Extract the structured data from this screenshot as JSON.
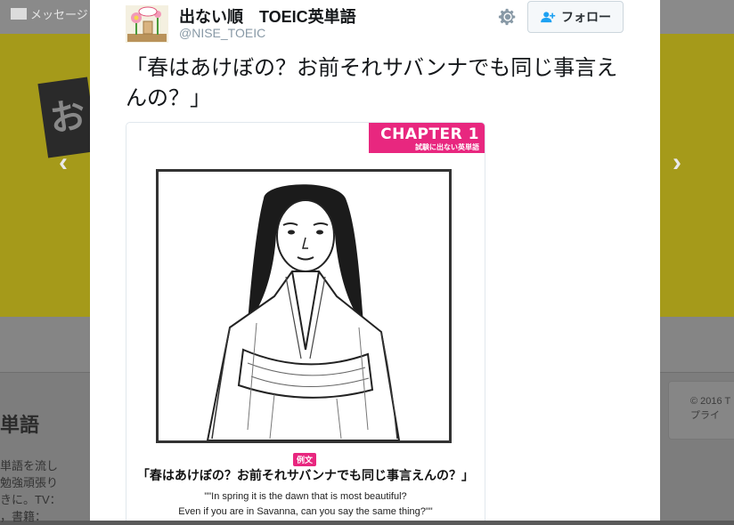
{
  "background": {
    "messages_label": "メッセージ",
    "logo_glyph": "お",
    "profile_name_fragment": "単語",
    "bio_lines": [
      "単語を流し",
      "勉強頑張り",
      "きに。TV：",
      "，書籍："
    ],
    "copyright_lines": [
      "© 2016 T",
      "プライ"
    ]
  },
  "tweet": {
    "author_name": "出ない順　TOEIC英単語",
    "author_handle": "@NISE_TOEIC",
    "follow_label": "フォロー",
    "text": "「春はあけぼの？お前それサバンナでも同じ事言えんの？」",
    "media": {
      "chapter_title": "CHAPTER 1",
      "chapter_subtitle": "試験に出ない英単語",
      "example_tag": "例文",
      "example_jp": "「春はあけぼの？お前それサバンナでも同じ事言えんの？」",
      "example_en_line1": "\"\"In spring it is the dawn that is most beautiful?",
      "example_en_line2": "Even if you are in Savanna, can you say the same thing?\"\""
    }
  },
  "icons": {
    "prev": "chevron-left-icon",
    "next": "chevron-right-icon",
    "gear": "gear-icon",
    "follow": "add-user-icon",
    "messages": "envelope-icon"
  },
  "colors": {
    "banner_yellow": "#a59a1a",
    "accent_pink": "#e8277f",
    "follow_text": "#292f33",
    "handle_gray": "#8899a6"
  }
}
